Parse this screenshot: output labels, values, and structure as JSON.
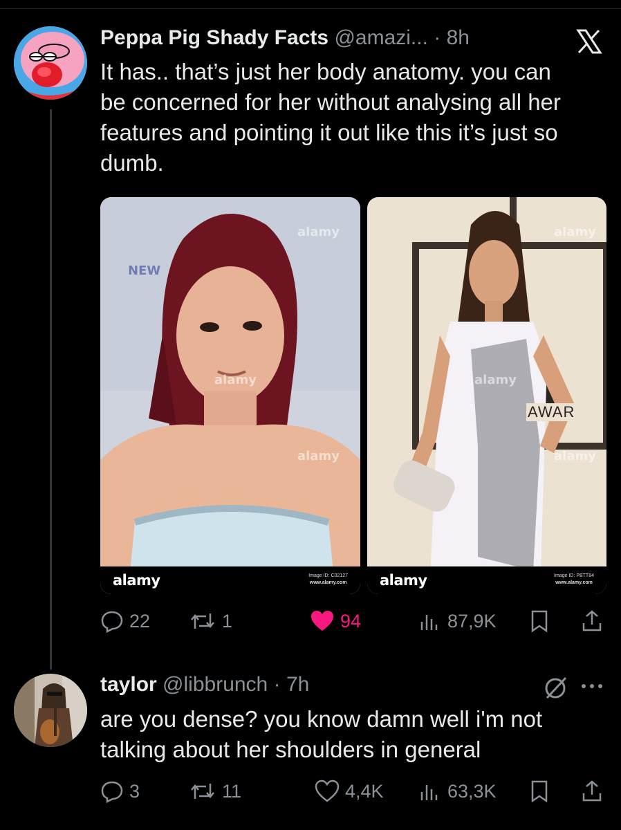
{
  "tweet1": {
    "display_name": "Peppa Pig Shady Facts",
    "handle": "@amazi...",
    "separator": "·",
    "time": "8h",
    "platform_icon": "x-logo-icon",
    "text_lines": [
      "It has.. that’s just her body anatomy. you can",
      "be concerned for her without analysing all her",
      "features and pointing it out like this it’s just so",
      "dumb."
    ],
    "media": [
      {
        "brand": "alamy",
        "image_id": "Image ID: C02127",
        "site": "www.alamy.com",
        "bg_text": "NEW"
      },
      {
        "brand": "alamy",
        "image_id": "Image ID: PBTT84",
        "site": "www.alamy.com",
        "bg_text": "AWAR"
      }
    ],
    "watermark": "alamy",
    "replies": "22",
    "reposts": "1",
    "likes": "94",
    "views": "87,9K",
    "like_color": "#f91880"
  },
  "tweet2": {
    "display_name": "taylor",
    "handle": "@libbrunch",
    "separator": "·",
    "time": "7h",
    "text_lines": [
      "are you dense? you know damn well i'm not",
      "talking about her shoulders in general"
    ],
    "replies": "3",
    "reposts": "11",
    "likes": "4,4K",
    "views": "63,3K"
  },
  "colors": {
    "background": "#000000",
    "text": "#e7e9ea",
    "secondary": "#8b9196",
    "thread_line": "#333639"
  }
}
